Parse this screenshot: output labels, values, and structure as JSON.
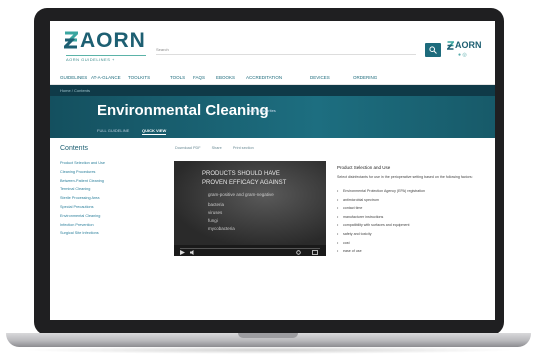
{
  "header": {
    "logo_text": "AORN",
    "logo_sub": "AORN GUIDELINES +",
    "search_label": "Search",
    "partner_logo": "AORN",
    "icons": [
      "search-icon",
      "user-icon",
      "help-icon"
    ]
  },
  "nav": {
    "items": [
      "GUIDELINES",
      "AT-A-GLANCE",
      "TOOLKITS",
      "TOOLS",
      "FAQS",
      "EBOOKS",
      "ACCREDITATION",
      "DEVICES",
      "ORDERING"
    ]
  },
  "breadcrumb": "Home / Contents",
  "page": {
    "title": "Environmental Cleaning",
    "favorite": "Add to favorites",
    "tabs": [
      "FULL GUIDELINE",
      "QUICK VIEW"
    ]
  },
  "sidebar": {
    "title": "Contents",
    "items": [
      "Product Selection and Use",
      "Cleaning Procedures",
      "Between-Patient Cleaning",
      "Terminal Cleaning",
      "Sterile Processing Area",
      "Special Precautions",
      "Environmental Cleaning",
      "Infection Prevention",
      "Surgical Site Infections"
    ]
  },
  "toolbar": {
    "items": [
      "Download PDF",
      "Share",
      "Print section"
    ]
  },
  "video": {
    "line1": "PRODUCTS SHOULD HAVE",
    "line2": "PROVEN EFFICACY AGAINST",
    "line3": "gram-positive and gram-negative",
    "line4": "bacteria",
    "line5": "viruses",
    "line6": "fungi",
    "line7": "mycobacteria"
  },
  "content": {
    "title": "Product Selection and Use",
    "intro": "Select disinfectants for use in the perioperative setting based on the following factors:",
    "bullets": [
      "Environmental Protection Agency (EPA) registration",
      "antimicrobial spectrum",
      "contact time",
      "manufacturer instructions",
      "compatibility with surfaces and equipment",
      "safety and toxicity",
      "cost",
      "ease of use"
    ]
  },
  "colors": {
    "brand_teal": "#1d6b7c",
    "banner_dark": "#14505f",
    "link": "#2a7f9b"
  }
}
